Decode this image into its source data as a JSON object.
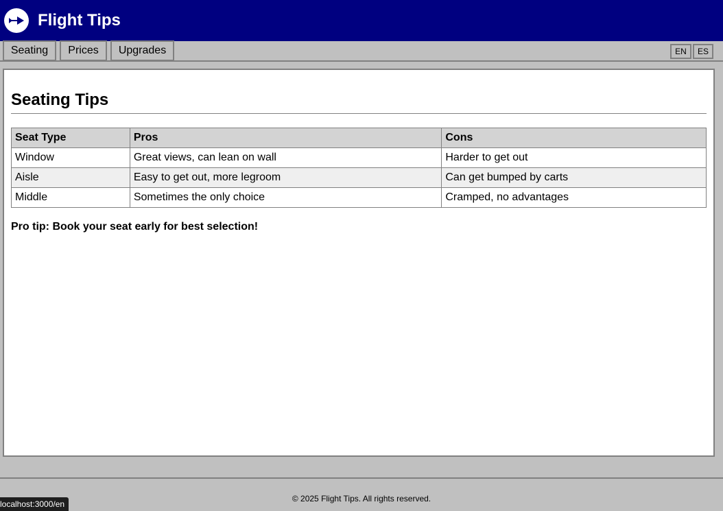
{
  "header": {
    "title": "Flight Tips",
    "logo_icon": "plane-icon"
  },
  "nav": {
    "tabs": [
      {
        "label": "Seating"
      },
      {
        "label": "Prices"
      },
      {
        "label": "Upgrades"
      }
    ],
    "languages": [
      "EN",
      "ES"
    ]
  },
  "main": {
    "title": "Seating Tips",
    "table": {
      "headers": [
        "Seat Type",
        "Pros",
        "Cons"
      ],
      "rows": [
        [
          "Window",
          "Great views, can lean on wall",
          "Harder to get out"
        ],
        [
          "Aisle",
          "Easy to get out, more legroom",
          "Can get bumped by carts"
        ],
        [
          "Middle",
          "Sometimes the only choice",
          "Cramped, no advantages"
        ]
      ]
    },
    "pro_tip": "Pro tip: Book your seat early for best selection!"
  },
  "footer": {
    "text": "© 2025 Flight Tips. All rights reserved."
  },
  "status_bar": {
    "url": "localhost:3000/en"
  },
  "colors": {
    "header_bg": "#000080",
    "chrome": "#c0c0c0",
    "border": "#808080"
  }
}
